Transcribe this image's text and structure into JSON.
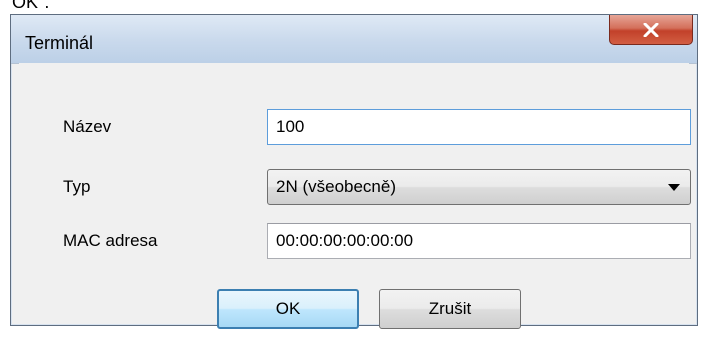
{
  "fragment_text": "OK\".",
  "dialog": {
    "title": "Terminál",
    "close_glyph": "close-icon"
  },
  "form": {
    "name_label": "Název",
    "name_value": "100",
    "type_label": "Typ",
    "type_value": "2N (všeobecně)",
    "mac_label": "MAC adresa",
    "mac_value": "00:00:00:00:00:00"
  },
  "buttons": {
    "ok_label": "OK",
    "cancel_label": "Zrušit"
  },
  "colors": {
    "close_button": "#c2412a",
    "default_button_border": "#3c7fb1",
    "focused_field_border": "#5d9ddb"
  }
}
